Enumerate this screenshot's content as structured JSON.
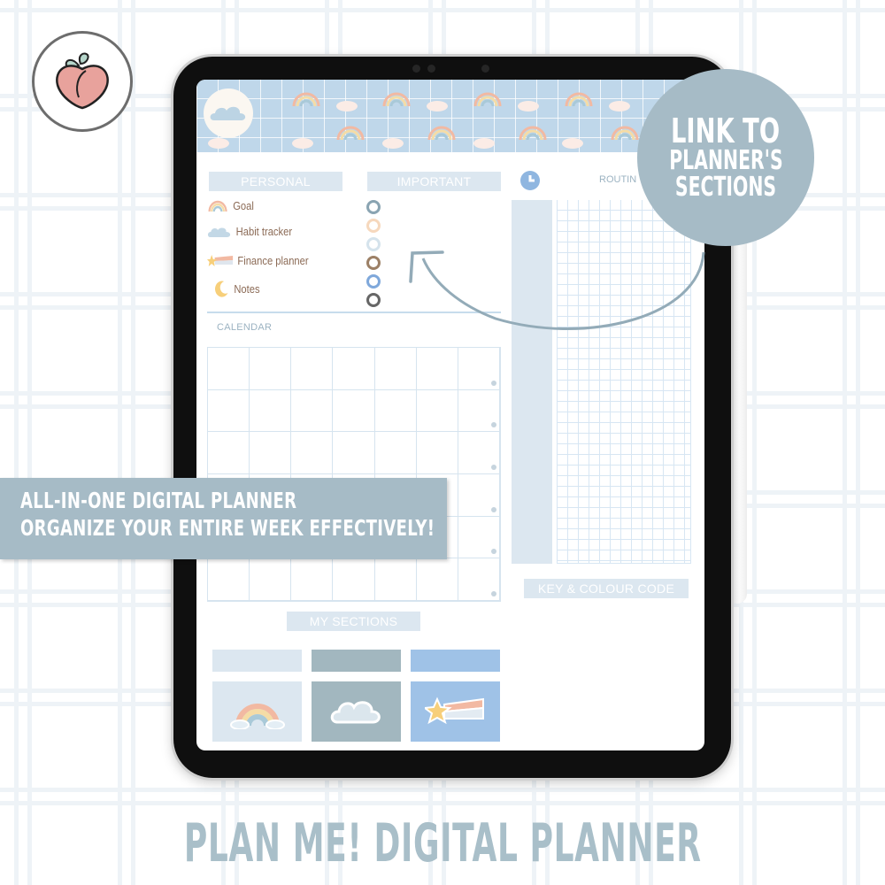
{
  "brand": {
    "logo_icon": "peach-icon"
  },
  "planner": {
    "banner_icon": "cloud-icon",
    "personal": {
      "header": "PERSONAL",
      "items": [
        {
          "label": "Goal",
          "icon": "rainbow-icon"
        },
        {
          "label": "Habit tracker",
          "icon": "cloud-icon"
        },
        {
          "label": "Finance planner",
          "icon": "shooting-star-icon"
        },
        {
          "label": "Notes",
          "icon": "moon-icon"
        }
      ]
    },
    "important": {
      "header": "IMPORTANT",
      "ring_colors": [
        "#8aa4b2",
        "#f6d8bd",
        "#d5e3ec",
        "#9c8066",
        "#7fa8db",
        "#666666"
      ]
    },
    "calendar": {
      "label": "CALENDAR",
      "rows": 6,
      "cols": 7
    },
    "routine": {
      "label": "ROUTIN",
      "icon": "clock-icon"
    },
    "key": {
      "header": "KEY & COLOUR CODE"
    },
    "sections": {
      "header": "MY SECTIONS",
      "tiles": [
        {
          "color": "#dce7f0",
          "icon": "rainbow-icon"
        },
        {
          "color": "#a2b7bf",
          "icon": "cloud-icon"
        },
        {
          "color": "#9fc2e7",
          "icon": "shooting-star-icon"
        }
      ]
    }
  },
  "callout": {
    "line1": "LINK TO",
    "line2": "PLANNER'S",
    "line3": "SECTIONS"
  },
  "promo": {
    "line1": "ALL-IN-ONE DIGITAL PLANNER",
    "line2": "ORGANIZE YOUR ENTIRE WEEK EFFECTIVELY!"
  },
  "footer": {
    "title": "PLAN ME! DIGITAL PLANNER"
  },
  "colors": {
    "accent": "#a6bbc6",
    "header_bg": "#dce7f0",
    "text_brown": "#8b6a55"
  }
}
